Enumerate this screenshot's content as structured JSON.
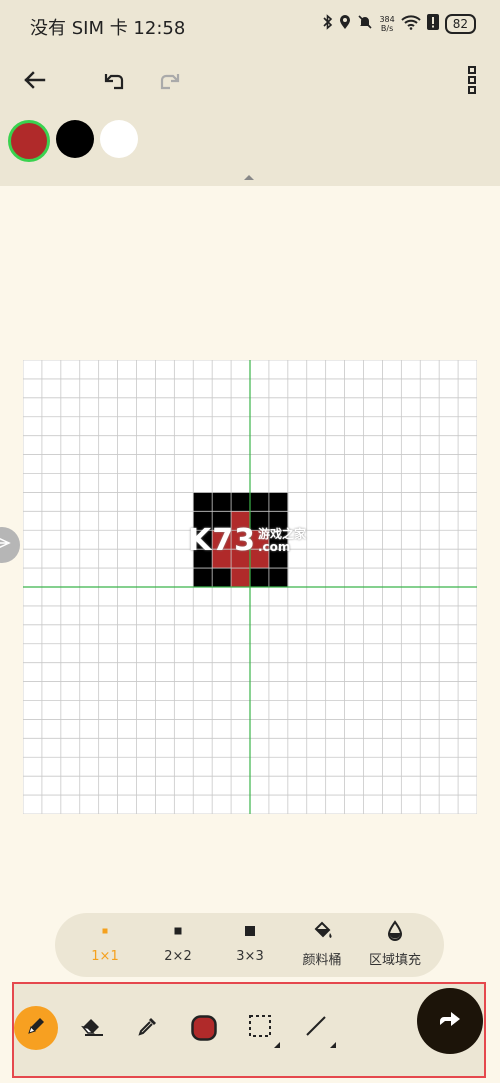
{
  "status": {
    "carrier_time": "没有 SIM 卡 12:58",
    "net_speed_value": "384",
    "net_speed_unit": "B/s",
    "battery": "82"
  },
  "toolbar": {
    "back_icon": "arrow-left-icon",
    "undo_icon": "undo-icon",
    "redo_icon": "redo-icon",
    "more_icon": "more-vertical-icon"
  },
  "palette": {
    "colors": [
      "#b02a2a",
      "#000000",
      "#ffffff"
    ],
    "selected_index": 0
  },
  "canvas": {
    "grid_size": 24,
    "center_line_color": "#3bb34a",
    "pixels": [
      {
        "col": 9,
        "row": 7,
        "color": "#000000"
      },
      {
        "col": 10,
        "row": 7,
        "color": "#000000"
      },
      {
        "col": 11,
        "row": 7,
        "color": "#000000"
      },
      {
        "col": 12,
        "row": 7,
        "color": "#000000"
      },
      {
        "col": 13,
        "row": 7,
        "color": "#000000"
      },
      {
        "col": 9,
        "row": 8,
        "color": "#000000"
      },
      {
        "col": 10,
        "row": 8,
        "color": "#000000"
      },
      {
        "col": 11,
        "row": 8,
        "color": "#b02a2a"
      },
      {
        "col": 12,
        "row": 8,
        "color": "#000000"
      },
      {
        "col": 13,
        "row": 8,
        "color": "#000000"
      },
      {
        "col": 9,
        "row": 9,
        "color": "#000000"
      },
      {
        "col": 10,
        "row": 9,
        "color": "#b02a2a"
      },
      {
        "col": 11,
        "row": 9,
        "color": "#b02a2a"
      },
      {
        "col": 12,
        "row": 9,
        "color": "#b02a2a"
      },
      {
        "col": 13,
        "row": 9,
        "color": "#000000"
      },
      {
        "col": 9,
        "row": 10,
        "color": "#000000"
      },
      {
        "col": 10,
        "row": 10,
        "color": "#b02a2a"
      },
      {
        "col": 11,
        "row": 10,
        "color": "#b02a2a"
      },
      {
        "col": 12,
        "row": 10,
        "color": "#b02a2a"
      },
      {
        "col": 13,
        "row": 10,
        "color": "#000000"
      },
      {
        "col": 9,
        "row": 11,
        "color": "#000000"
      },
      {
        "col": 10,
        "row": 11,
        "color": "#000000"
      },
      {
        "col": 11,
        "row": 11,
        "color": "#b02a2a"
      },
      {
        "col": 12,
        "row": 11,
        "color": "#000000"
      },
      {
        "col": 13,
        "row": 11,
        "color": "#000000"
      }
    ]
  },
  "watermark": {
    "main": "K73",
    "sub_top": "游戏之家",
    "sub_bottom": ".com"
  },
  "brush_sizes": [
    {
      "label": "1×1",
      "icon": "brush-1x1-icon",
      "active": true
    },
    {
      "label": "2×2",
      "icon": "brush-2x2-icon",
      "active": false
    },
    {
      "label": "3×3",
      "icon": "brush-3x3-icon",
      "active": false
    },
    {
      "label": "颜料桶",
      "icon": "paint-bucket-icon",
      "active": false
    },
    {
      "label": "区域填充",
      "icon": "area-fill-icon",
      "active": false
    }
  ],
  "tools": {
    "pencil_icon": "pencil-icon",
    "eraser_icon": "eraser-icon",
    "eyedropper_icon": "eyedropper-icon",
    "color_icon": "current-color-icon",
    "select_icon": "selection-icon",
    "line_icon": "line-icon",
    "next_icon": "next-arrow-icon",
    "current_color": "#b02a2a",
    "active_tool": "pencil"
  }
}
